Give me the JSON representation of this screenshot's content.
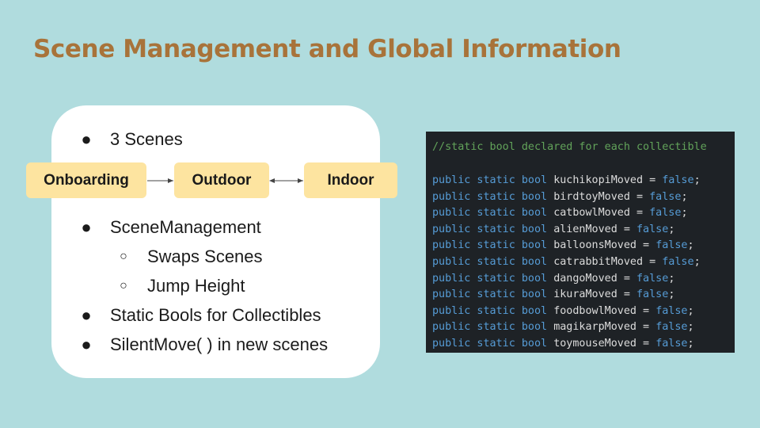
{
  "title": "Scene Management and Global Information",
  "bullets": {
    "scenes": "3 Scenes",
    "scene_management": "SceneManagement",
    "swaps_scenes": "Swaps Scenes",
    "jump_height": "Jump Height",
    "static_bools": "Static Bools for Collectibles",
    "silent_move": "SilentMove( ) in new scenes"
  },
  "bullet_glyphs": {
    "filled": "●",
    "hollow": "○"
  },
  "flow": {
    "onboarding": "Onboarding",
    "outdoor": "Outdoor",
    "indoor": "Indoor"
  },
  "code": {
    "comment": "//static bool declared for each collectible",
    "keywords": "public static bool",
    "equals": " = ",
    "value": "false",
    "semicolon": ";",
    "variables": [
      "kuchikopiMoved",
      "birdtoyMoved",
      "catbowlMoved",
      "alienMoved",
      "balloonsMoved",
      "catrabbitMoved",
      "dangoMoved",
      "ikuraMoved",
      "foodbowlMoved",
      "magikarpMoved",
      "toymouseMoved"
    ]
  },
  "colors": {
    "background": "#b0dcde",
    "title": "#a8733a",
    "flow_box": "#fde4a0",
    "code_bg": "#1e2226",
    "code_keyword": "#569cd6",
    "code_comment": "#62a35a",
    "code_text": "#dcdcdc"
  }
}
